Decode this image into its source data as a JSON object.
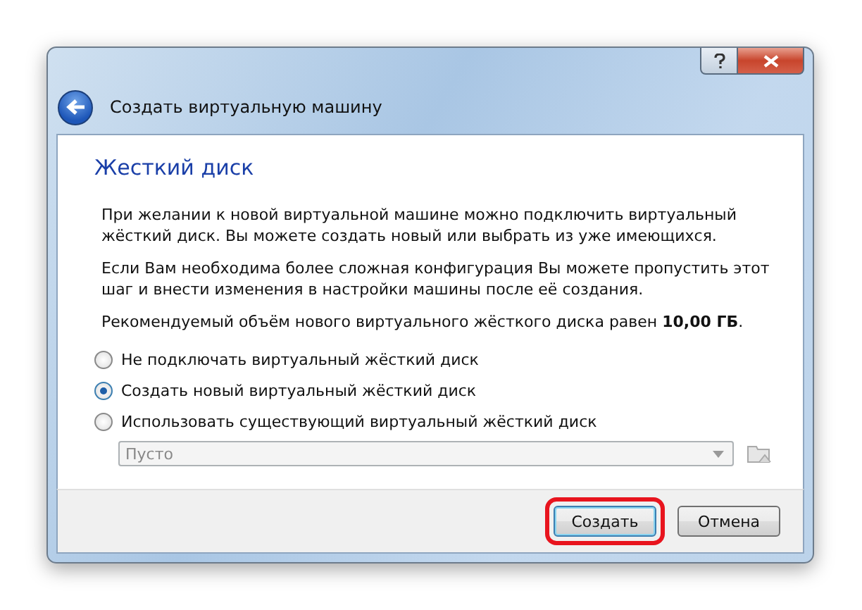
{
  "window": {
    "title": "Создать виртуальную машину"
  },
  "page": {
    "heading": "Жесткий диск",
    "paragraphs": [
      "При желании к новой виртуальной машине можно подключить виртуальный жёсткий диск. Вы можете создать новый или выбрать из уже имеющихся.",
      "Если Вам необходима более сложная конфигурация Вы можете пропустить этот шаг и внести изменения в настройки машины после её создания.",
      "Рекомендуемый объём нового виртуального жёсткого диска равен **10,00 ГБ**."
    ]
  },
  "options": [
    {
      "label": "Не подключать виртуальный жёсткий диск",
      "selected": false
    },
    {
      "label": "Создать новый виртуальный жёсткий диск",
      "selected": true
    },
    {
      "label": "Использовать существующий виртуальный жёсткий диск",
      "selected": false
    }
  ],
  "disk_select": {
    "value": "Пусто",
    "disabled": true
  },
  "buttons": [
    {
      "label": "Создать",
      "highlighted": true
    },
    {
      "label": "Отмена",
      "highlighted": false
    }
  ]
}
